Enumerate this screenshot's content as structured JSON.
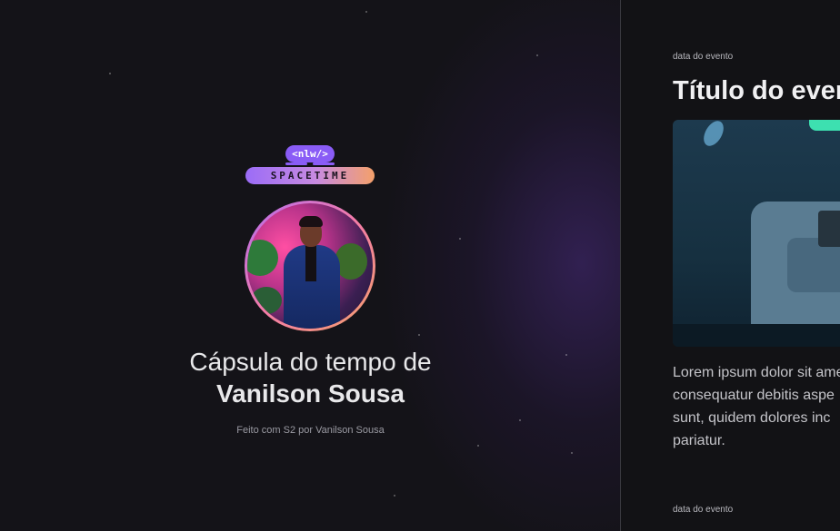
{
  "logo": {
    "tag": "<nlw/>",
    "name": "SPACETIME"
  },
  "profile": {
    "heading_line1": "Cápsula do tempo de",
    "heading_line2": "Vanilson Sousa",
    "credit": "Feito com S2 por Vanilson Sousa"
  },
  "memory": {
    "date": "data do evento",
    "title": "Título do evento",
    "description_lines": [
      "Lorem ipsum dolor sit amet",
      "consequatur debitis aspe",
      "sunt, quidem dolores inc",
      "pariatur."
    ],
    "next_date": "data do evento"
  },
  "colors": {
    "background": "#121215",
    "accent_purple": "#8a5cf6",
    "accent_orange": "#f4a06a"
  }
}
